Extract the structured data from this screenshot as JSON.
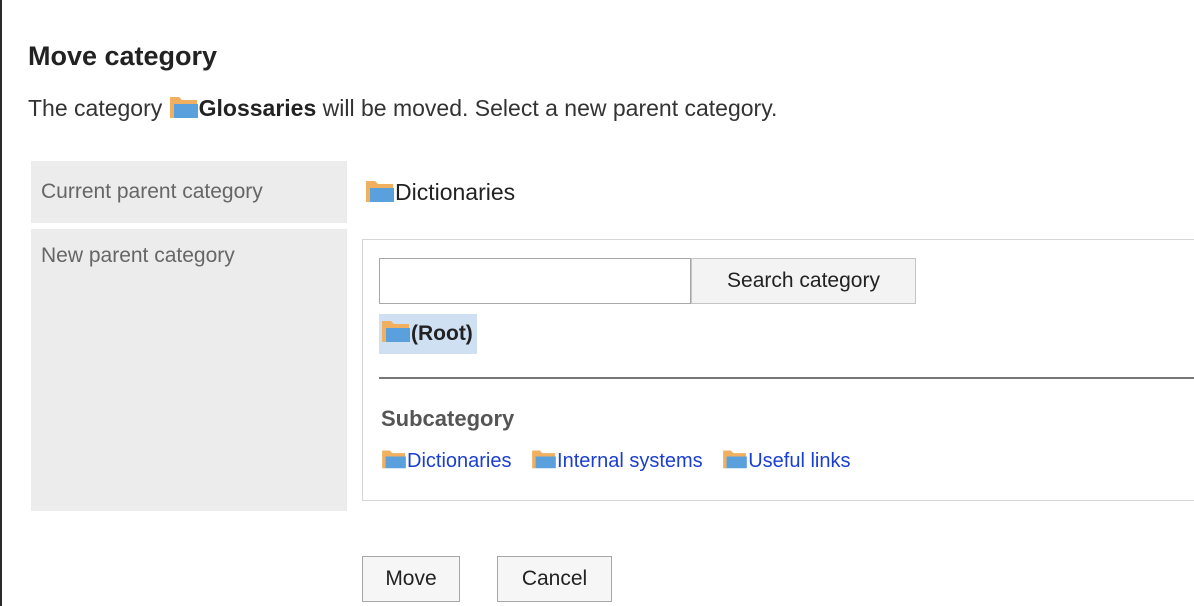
{
  "page": {
    "title": "Move category",
    "description_prefix": "The category ",
    "moved_category": "Glossaries",
    "description_suffix": " will be moved. Select a new parent category."
  },
  "form": {
    "current_parent_label": "Current parent category",
    "current_parent_value": "Dictionaries",
    "new_parent_label": "New parent category"
  },
  "picker": {
    "search_value": "",
    "search_button_label": "Search category",
    "selected_item": "(Root)",
    "subcategory_heading": "Subcategory",
    "subcategories": [
      {
        "label": "Dictionaries",
        "icon": "folder-icon"
      },
      {
        "label": "Internal systems",
        "icon": "folder-icon"
      },
      {
        "label": "Useful links",
        "icon": "folder-icon"
      }
    ]
  },
  "actions": {
    "move_label": "Move",
    "cancel_label": "Cancel"
  },
  "colors": {
    "folder_back": "#f0b060",
    "folder_front": "#5aa0dc",
    "selected_bg": "#cfe0f3",
    "link": "#1a3fd0",
    "label_bg": "#ececec"
  }
}
